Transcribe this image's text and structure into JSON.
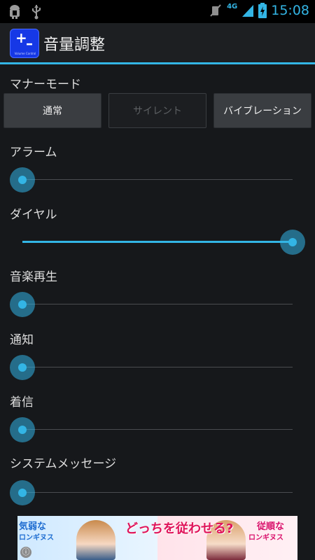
{
  "status_bar": {
    "time": "15:08",
    "network": "4G",
    "icons": [
      "android-debug-icon",
      "usb-icon",
      "mute-icon",
      "signal-icon",
      "battery-charging-icon"
    ]
  },
  "app": {
    "title": "音量調整",
    "icon_caption": "Volume Control"
  },
  "manner_mode": {
    "label": "マナーモード",
    "buttons": [
      {
        "label": "通常",
        "enabled": true
      },
      {
        "label": "サイレント",
        "enabled": false
      },
      {
        "label": "バイブレーション",
        "enabled": true
      }
    ]
  },
  "sliders": [
    {
      "label": "アラーム",
      "level": 0.0
    },
    {
      "label": "ダイヤル",
      "level": 1.0
    },
    {
      "label": "音楽再生",
      "level": 0.0
    },
    {
      "label": "通知",
      "level": 0.0
    },
    {
      "label": "着信",
      "level": 0.0
    },
    {
      "label": "システムメッセージ",
      "level": 0.0
    }
  ],
  "ad": {
    "left_text": "気弱な",
    "left_sub": "ロンギヌス",
    "center_text": "どっちを従わせる?",
    "right_text": "従順な",
    "right_sub": "ロンギヌス",
    "info_icon": "ⓘ"
  },
  "colors": {
    "accent": "#33b5e5",
    "background": "#16181b",
    "app_icon": "#1638e6"
  }
}
